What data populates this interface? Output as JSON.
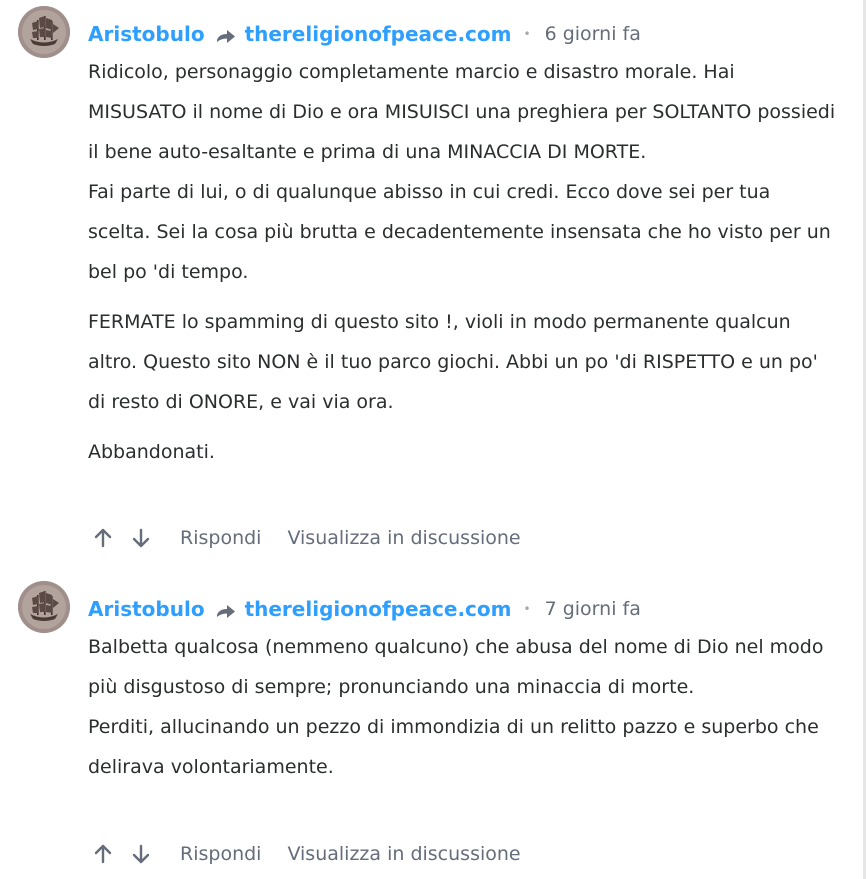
{
  "comments": [
    {
      "author": "Aristobulo",
      "parent_author": "thereligionofpeace.com",
      "time": "6 giorni fa",
      "paragraphs": [
        "Ridicolo, personaggio completamente marcio e disastro morale. Hai MISUSATO il nome di Dio e ora MISUISCI una preghiera per SOLTANTO possiedi il bene auto-esaltante e prima di una MINACCIA DI MORTE.\nFai parte di lui, o di qualunque abisso in cui credi. Ecco dove sei per tua scelta. Sei la cosa più brutta e decadentemente insensata che ho visto per un bel po 'di tempo.",
        "FERMATE lo spamming di questo sito !, violi in modo permanente qualcun altro. Questo sito NON è il tuo parco giochi. Abbi un po 'di RISPETTO e un po' di resto di ONORE, e vai via ora.",
        "Abbandonati."
      ],
      "reply_label": "Rispondi",
      "view_label": "Visualizza in discussione"
    },
    {
      "author": "Aristobulo",
      "parent_author": "thereligionofpeace.com",
      "time": "7 giorni fa",
      "paragraphs": [
        "Balbetta qualcosa (nemmeno qualcuno) che abusa del nome di Dio nel modo più disgustoso di sempre; pronunciando una minaccia di morte.\nPerditi, allucinando un pezzo di immondizia di un relitto pazzo e superbo che delirava volontariamente."
      ],
      "reply_label": "Rispondi",
      "view_label": "Visualizza in discussione"
    }
  ],
  "icons": {
    "avatar": "sailing-ship-avatar-icon",
    "reply_arrow": "reply-arrow-icon",
    "upvote": "arrow-up-icon",
    "downvote": "arrow-down-icon"
  },
  "colors": {
    "link": "#2e9fff",
    "text": "#2a2e2e",
    "muted": "#656c7a"
  }
}
